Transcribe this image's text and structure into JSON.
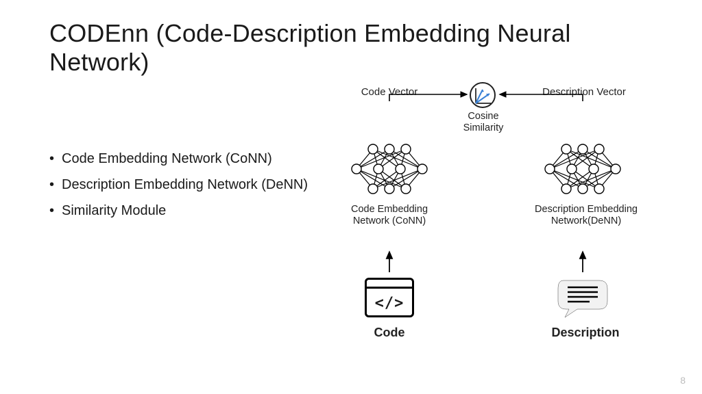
{
  "title": "CODEnn (Code-Description Embedding Neural Network)",
  "bullets": [
    "Code Embedding Network (CoNN)",
    "Description Embedding Network (DeNN)",
    "Similarity Module"
  ],
  "diagram": {
    "code_vector": "Code Vector",
    "desc_vector": "Description Vector",
    "cosine": "Cosine Similarity",
    "conn_label": "Code Embedding Network (CoNN)",
    "denn_label": "Description Embedding Network(DeNN)",
    "code": "Code",
    "description": "Description",
    "code_glyph": "</>"
  },
  "page_number": "8"
}
